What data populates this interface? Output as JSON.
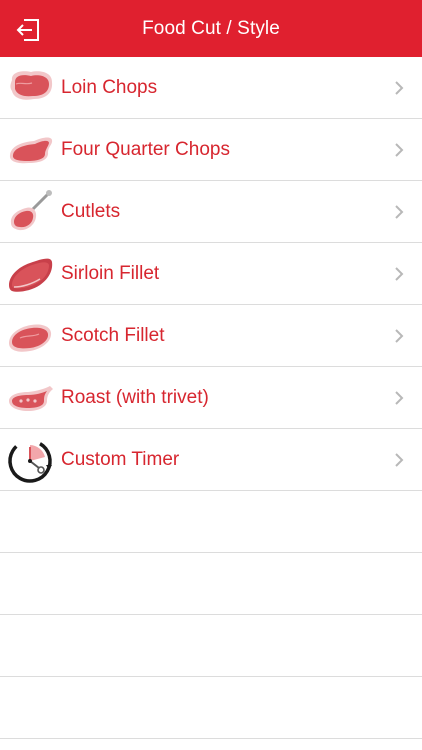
{
  "header": {
    "title": "Food Cut / Style",
    "back_icon": "back-arrow-icon",
    "bg": "#e0202f"
  },
  "items": [
    {
      "label": "Loin Chops",
      "icon": "loin-chops-icon"
    },
    {
      "label": "Four Quarter Chops",
      "icon": "four-quarter-chops-icon"
    },
    {
      "label": "Cutlets",
      "icon": "cutlets-icon"
    },
    {
      "label": "Sirloin Fillet",
      "icon": "sirloin-fillet-icon"
    },
    {
      "label": "Scotch Fillet",
      "icon": "scotch-fillet-icon"
    },
    {
      "label": "Roast (with trivet)",
      "icon": "roast-icon"
    },
    {
      "label": "Custom Timer",
      "icon": "custom-timer-icon"
    }
  ],
  "colors": {
    "accent": "#e0202f",
    "label": "#d7262f",
    "meat": "#d9535a",
    "divider": "#dcdcdc",
    "chevron": "#b8b8b8"
  }
}
